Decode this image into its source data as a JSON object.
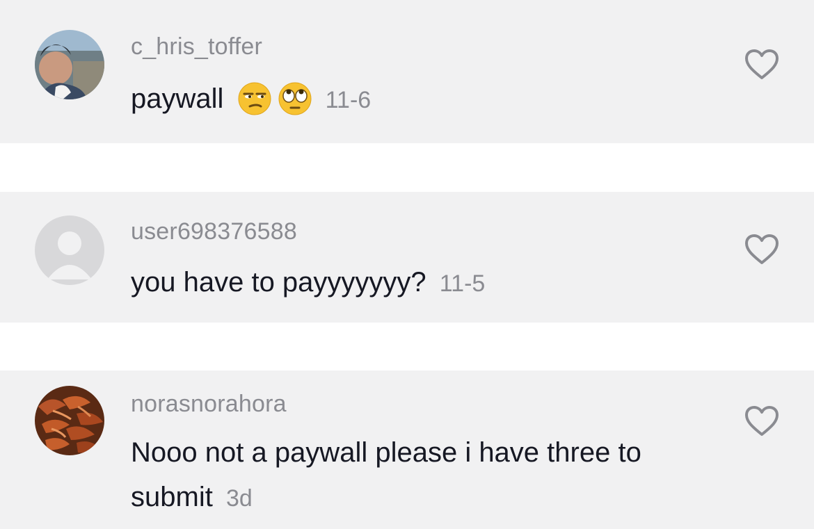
{
  "comments": [
    {
      "username": "c_hris_toffer",
      "text": "paywall",
      "emojis": [
        "unamused-face-icon",
        "face-with-rolling-eyes-icon"
      ],
      "date": "11-6",
      "avatar": "photo-avatar"
    },
    {
      "username": "user698376588",
      "text": "you have to payyyyyyy?",
      "date": "11-5",
      "avatar": "default-avatar"
    },
    {
      "username": "norasnorahora",
      "text": "Nooo not a paywall please i have three to submit",
      "date": "3d",
      "avatar": "photo-avatar"
    }
  ],
  "icons": {
    "like": "heart-outline-icon"
  },
  "colors": {
    "background": "#ffffff",
    "comment_bg": "#f1f1f2",
    "username": "#8a8b91",
    "text": "#161823"
  }
}
